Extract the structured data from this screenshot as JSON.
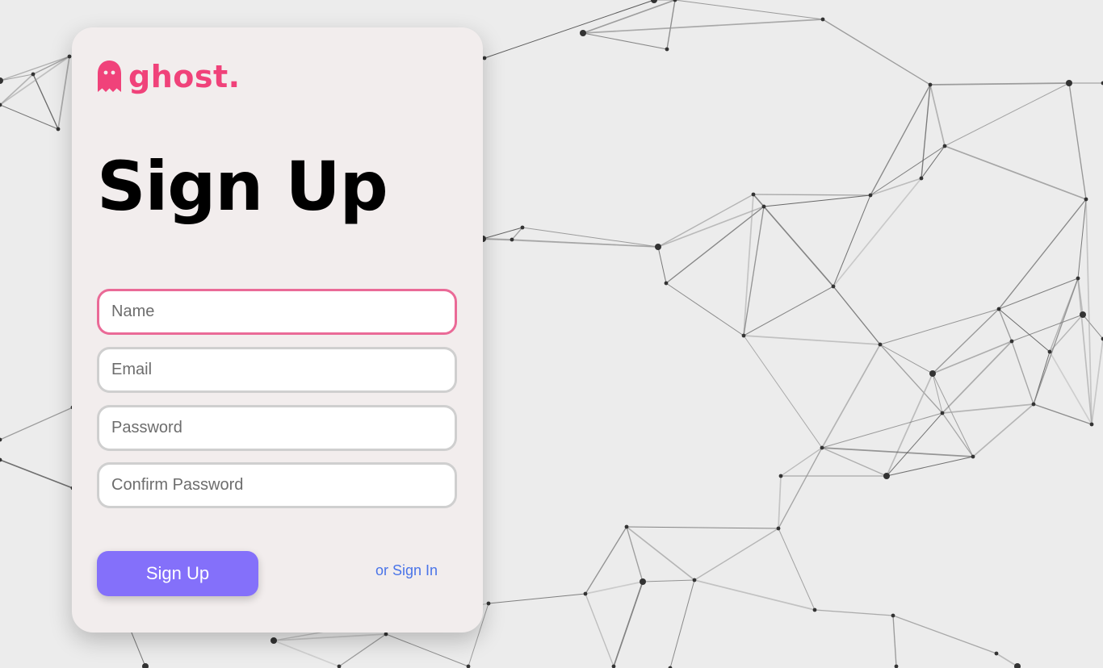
{
  "app": {
    "logo_text": "ghost."
  },
  "page": {
    "title": "Sign Up"
  },
  "form": {
    "name_placeholder": "Name",
    "email_placeholder": "Email",
    "password_placeholder": "Password",
    "confirm_placeholder": "Confirm Password",
    "submit_label": "Sign Up",
    "signin_link": "or Sign In"
  },
  "colors": {
    "brand": "#f0427a",
    "button": "#8470fa",
    "link": "#4a74e8",
    "focus_border": "#ea6a97",
    "card": "#f2eded",
    "background": "#ececec"
  },
  "icons": {
    "logo": "ghost-icon"
  }
}
